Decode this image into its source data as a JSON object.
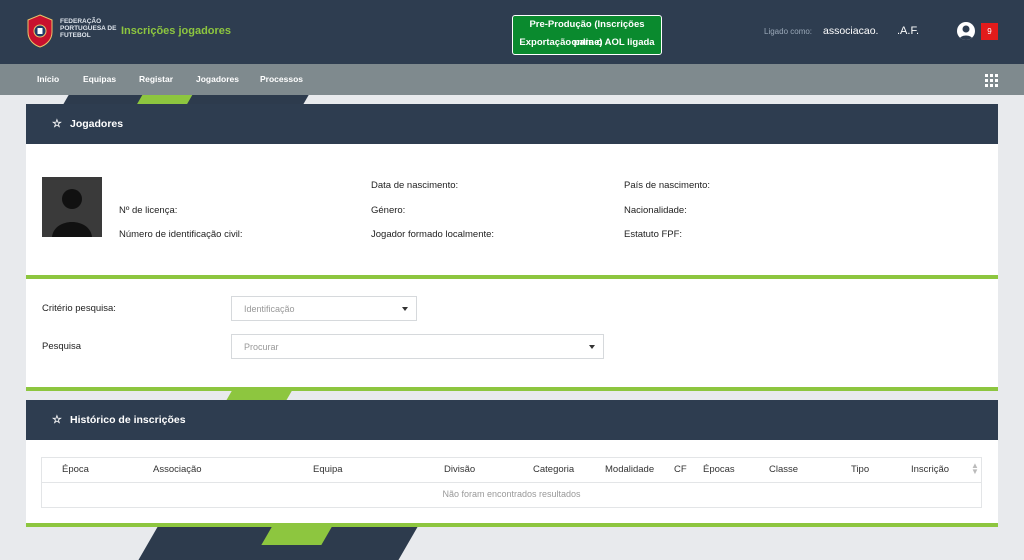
{
  "header": {
    "org_name": "FEDERAÇÃO PORTUGUESA DE FUTEBOL",
    "app_title": "Inscrições jogadores",
    "env_line1": "Pre-Produção (Inscrições online)",
    "env_line2": "Exportação para o AOL ligada",
    "logged_label": "Ligado como:",
    "logged_user": "associacao.",
    "logged_org": ".A.F.",
    "notifications": "9"
  },
  "nav": {
    "items": [
      "Início",
      "Equipas",
      "Registar",
      "Jogadores",
      "Processos"
    ]
  },
  "player_panel": {
    "title": "Jogadores",
    "fields": {
      "license": "Nº de licença:",
      "civil_id": "Número de identificação civil:",
      "birth_date": "Data de nascimento:",
      "gender": "Género:",
      "local_trained": "Jogador formado localmente:",
      "birth_country": "País de nascimento:",
      "nationality": "Nacionalidade:",
      "fpf_status": "Estatuto FPF:"
    }
  },
  "search": {
    "criteria_label": "Critério pesquisa:",
    "criteria_value": "Identificação",
    "search_label": "Pesquisa",
    "search_placeholder": "Procurar"
  },
  "history_panel": {
    "title": "Histórico de inscrições",
    "columns": [
      "Época",
      "Associação",
      "Equipa",
      "Divisão",
      "Categoria",
      "Modalidade",
      "CF",
      "Épocas",
      "Classe",
      "Tipo",
      "Inscrição"
    ],
    "empty_text": "Não foram encontrados resultados"
  },
  "colors": {
    "header_bg": "#2e3d50",
    "accent_green": "#8dc63f",
    "env_badge_green": "#0a8a2e",
    "nav_bg": "#7f8a8e",
    "badge_red": "#e31b1b"
  }
}
